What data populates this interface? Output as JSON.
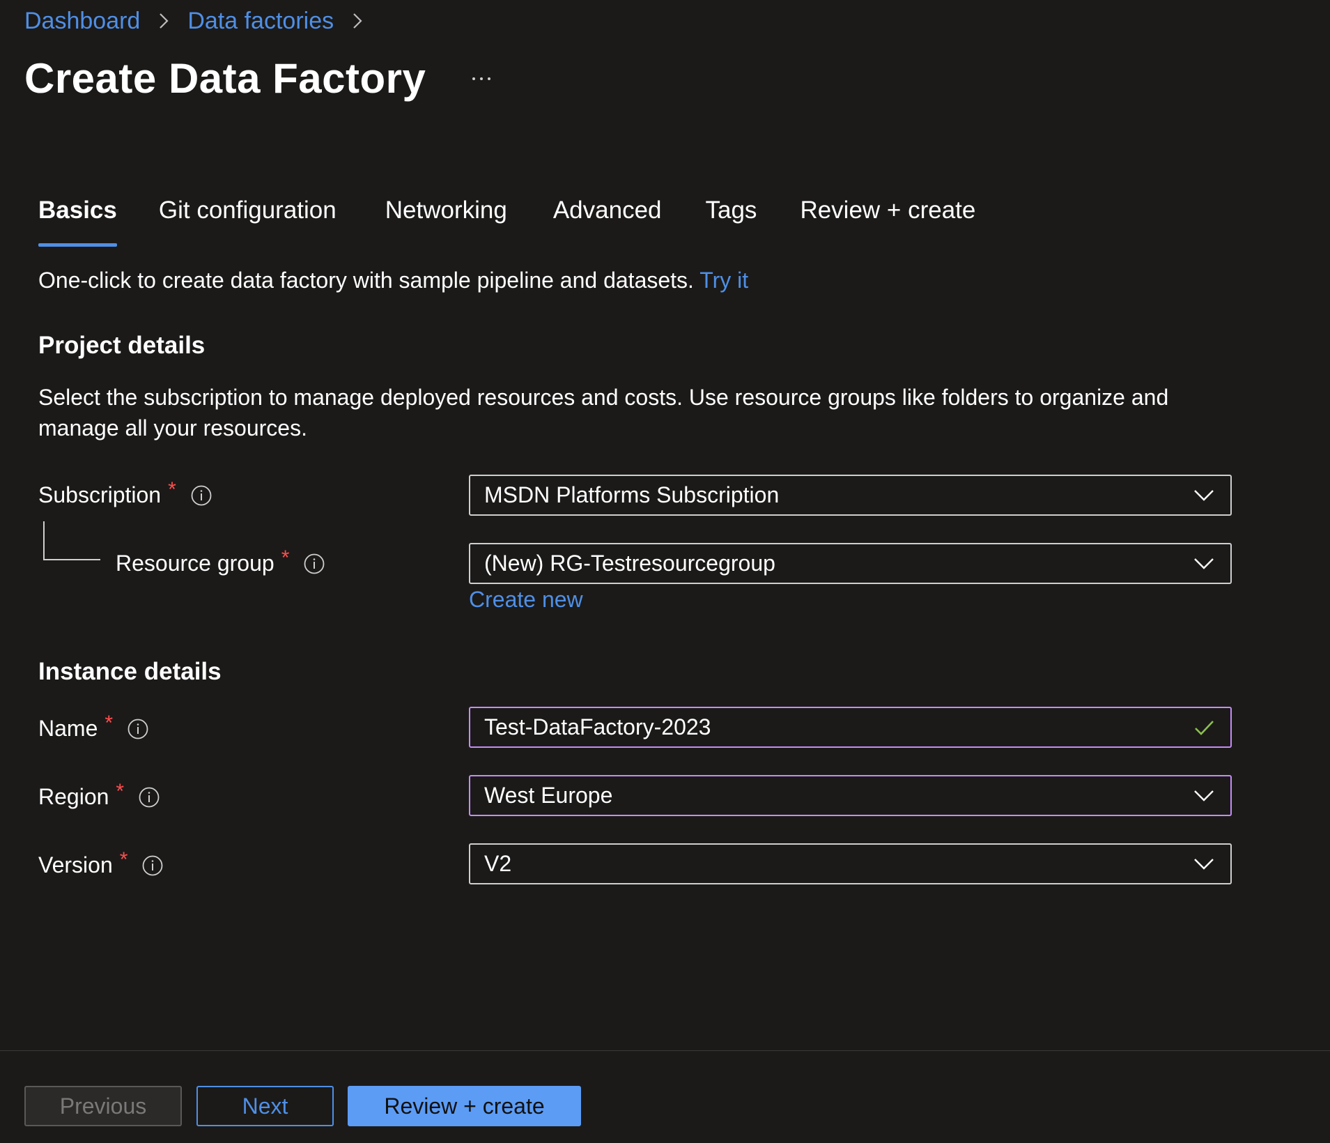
{
  "breadcrumb": {
    "items": [
      "Dashboard",
      "Data factories"
    ]
  },
  "page": {
    "title": "Create Data Factory",
    "more_label": "···"
  },
  "tabs": [
    {
      "label": "Basics",
      "active": true
    },
    {
      "label": "Git configuration",
      "active": false
    },
    {
      "label": "Networking",
      "active": false
    },
    {
      "label": "Advanced",
      "active": false
    },
    {
      "label": "Tags",
      "active": false
    },
    {
      "label": "Review + create",
      "active": false
    }
  ],
  "intro": {
    "text": "One-click to create data factory with sample pipeline and datasets.",
    "link": "Try it"
  },
  "project_details": {
    "heading": "Project details",
    "description": "Select the subscription to manage deployed resources and costs. Use resource groups like folders to organize and manage all your resources.",
    "subscription": {
      "label": "Subscription",
      "value": "MSDN Platforms Subscription"
    },
    "resource_group": {
      "label": "Resource group",
      "value": "(New) RG-Testresourcegroup",
      "create_new": "Create new"
    }
  },
  "instance_details": {
    "heading": "Instance details",
    "name": {
      "label": "Name",
      "value": "Test-DataFactory-2023"
    },
    "region": {
      "label": "Region",
      "value": "West Europe"
    },
    "version": {
      "label": "Version",
      "value": "V2"
    }
  },
  "required_marker": "*",
  "footer": {
    "previous": "Previous",
    "next": "Next",
    "review_create": "Review + create"
  },
  "colors": {
    "background": "#1b1a19",
    "link": "#4f8fe6",
    "focus_border": "#c68cf5",
    "valid_check": "#8cc04f",
    "required": "#ff4d4d",
    "primary_button": "#5c9cf5"
  },
  "icons": {
    "breadcrumb_separator": "chevron-right-icon",
    "info": "info-icon",
    "dropdown": "chevron-down-icon",
    "valid": "checkmark-icon",
    "more": "ellipsis-icon"
  }
}
